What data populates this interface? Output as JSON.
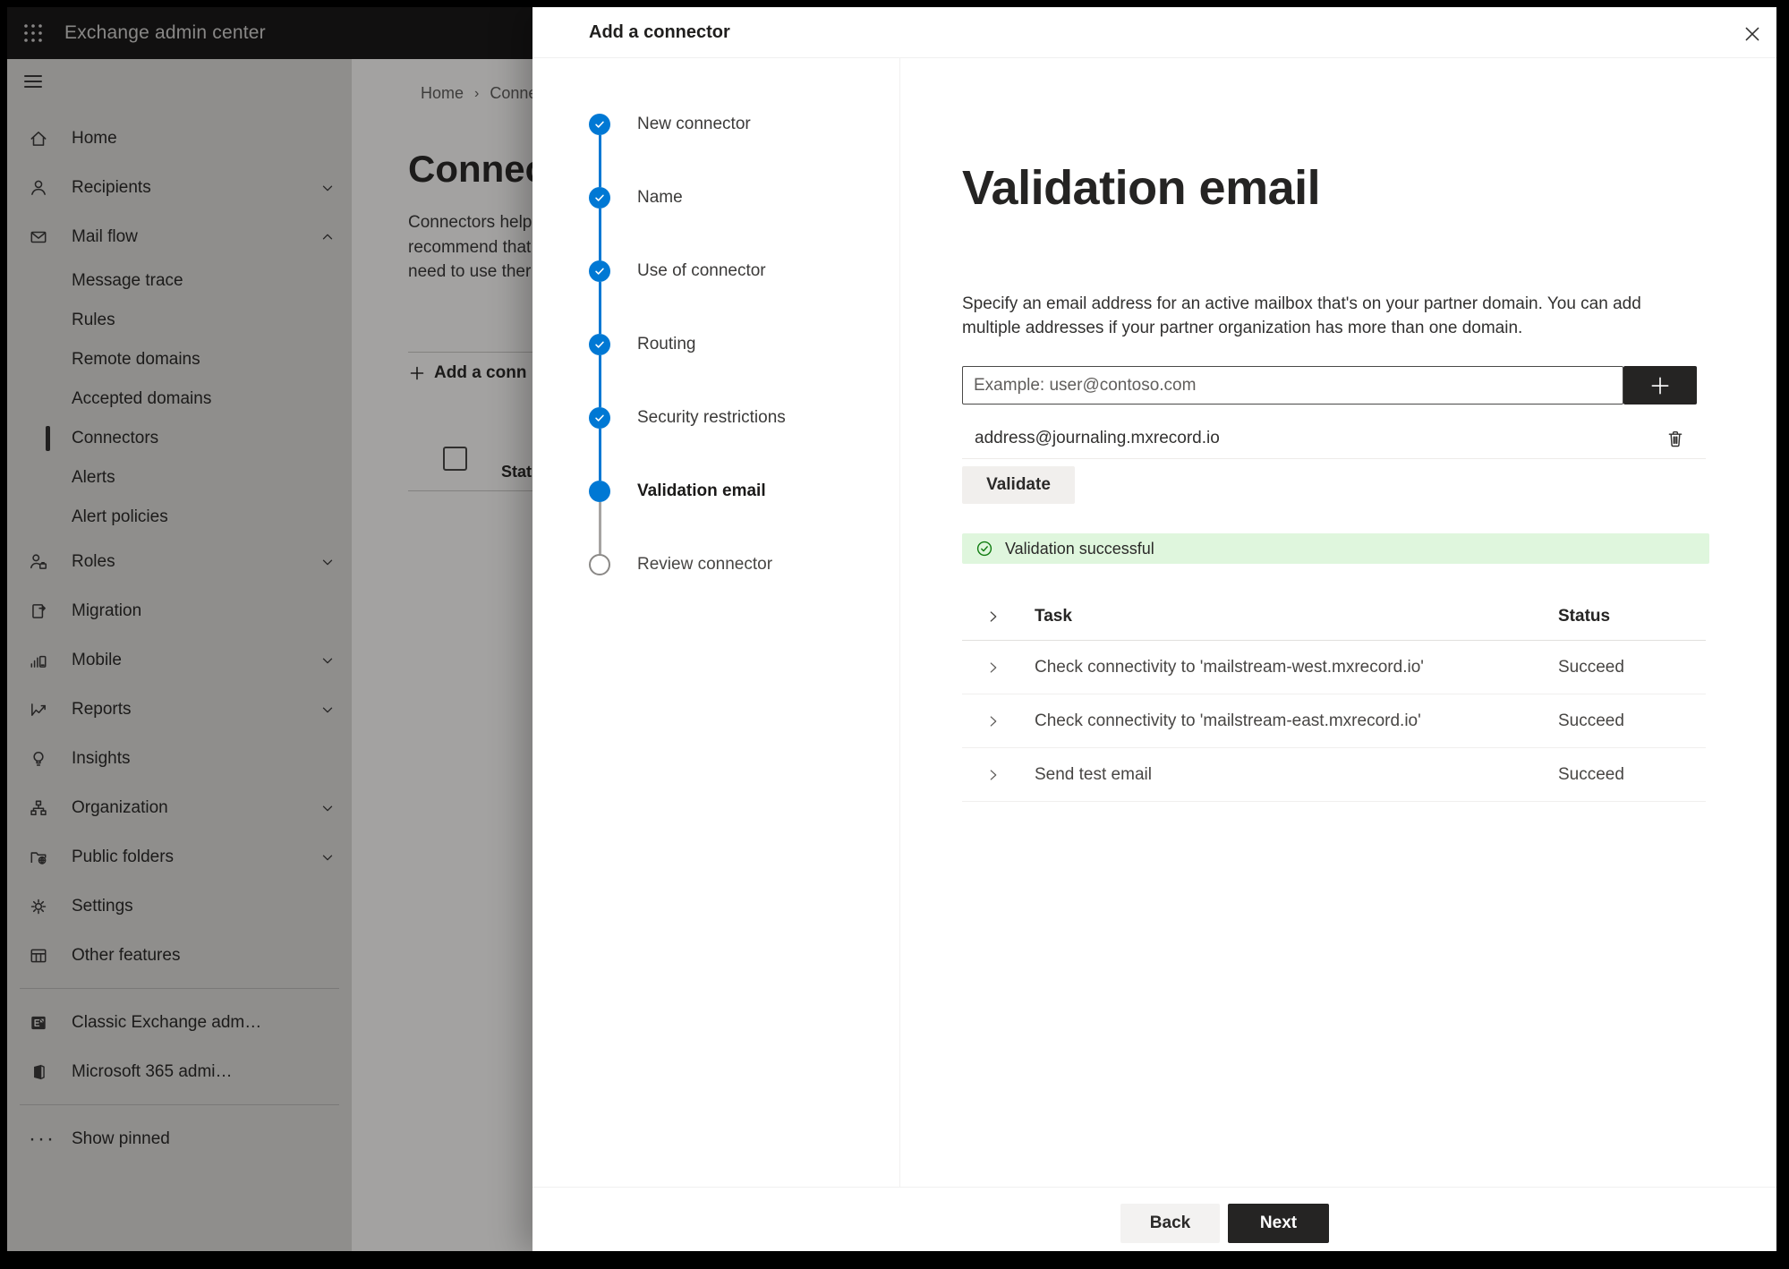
{
  "app_bar": {
    "title": "Exchange admin center"
  },
  "sidebar": {
    "items": [
      {
        "label": "Home"
      },
      {
        "label": "Recipients"
      },
      {
        "label": "Mail flow"
      },
      {
        "label": "Message trace"
      },
      {
        "label": "Rules"
      },
      {
        "label": "Remote domains"
      },
      {
        "label": "Accepted domains"
      },
      {
        "label": "Connectors",
        "selected": true
      },
      {
        "label": "Alerts"
      },
      {
        "label": "Alert policies"
      },
      {
        "label": "Roles"
      },
      {
        "label": "Migration"
      },
      {
        "label": "Mobile"
      },
      {
        "label": "Reports"
      },
      {
        "label": "Insights"
      },
      {
        "label": "Organization"
      },
      {
        "label": "Public folders"
      },
      {
        "label": "Settings"
      },
      {
        "label": "Other features"
      },
      {
        "label": "Classic Exchange adm…"
      },
      {
        "label": "Microsoft 365 admi…"
      },
      {
        "label": "Show pinned"
      }
    ]
  },
  "background_page": {
    "breadcrumb_home": "Home",
    "breadcrumb_sep": "›",
    "breadcrumb_current": "Conne",
    "title": "Connect",
    "line1": "Connectors help",
    "line2": "recommend that",
    "line3": "need to use ther",
    "add_button": "Add a conn",
    "status_header": "Status"
  },
  "wizard": {
    "title": "Add a connector",
    "steps": [
      {
        "label": "New connector",
        "state": "completed"
      },
      {
        "label": "Name",
        "state": "completed"
      },
      {
        "label": "Use of connector",
        "state": "completed"
      },
      {
        "label": "Routing",
        "state": "completed"
      },
      {
        "label": "Security restrictions",
        "state": "completed"
      },
      {
        "label": "Validation email",
        "state": "current"
      },
      {
        "label": "Review connector",
        "state": "upcoming"
      }
    ],
    "page": {
      "heading": "Validation email",
      "description": "Specify an email address for an active mailbox that's on your partner domain. You can add multiple addresses if your partner organization has more than one domain.",
      "email_placeholder": "Example: user@contoso.com",
      "address": "address@journaling.mxrecord.io",
      "validate_label": "Validate",
      "banner_text": "Validation successful",
      "table": {
        "task_header": "Task",
        "status_header": "Status",
        "rows": [
          {
            "task": "Check connectivity to 'mailstream-west.mxrecord.io'",
            "status": "Succeed"
          },
          {
            "task": "Check connectivity to 'mailstream-east.mxrecord.io'",
            "status": "Succeed"
          },
          {
            "task": "Send test email",
            "status": "Succeed"
          }
        ]
      },
      "back_label": "Back",
      "next_label": "Next"
    }
  },
  "colors": {
    "accent": "#0078d4",
    "success_bg": "#dff6dd",
    "success_icon": "#107c10",
    "primary_button": "#252423",
    "topbar": "#1b1a19"
  }
}
